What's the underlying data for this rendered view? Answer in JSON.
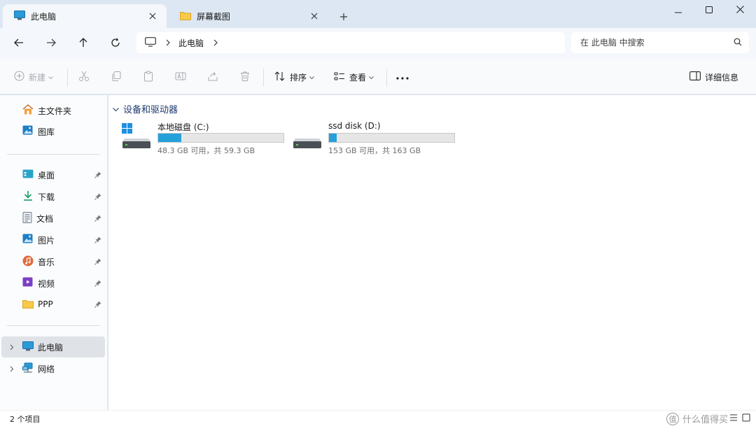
{
  "colors": {
    "accent": "#26a0da",
    "tabbar_bg": "#dde7f3",
    "group_header": "#1e3a6e"
  },
  "tabs": [
    {
      "label": "此电脑",
      "icon": "monitor-icon",
      "active": true
    },
    {
      "label": "屏幕截图",
      "icon": "folder-icon",
      "active": false
    }
  ],
  "window_controls": {
    "minimize": "minimize-icon",
    "maximize": "maximize-icon",
    "close": "close-icon"
  },
  "address": {
    "crumbs": [
      "此电脑"
    ],
    "search_placeholder": "在 此电脑 中搜索"
  },
  "commands": {
    "new": "新建",
    "sort": "排序",
    "view": "查看",
    "details": "详细信息"
  },
  "sidebar": {
    "top": [
      {
        "label": "主文件夹",
        "icon": "home-icon"
      },
      {
        "label": "图库",
        "icon": "gallery-icon"
      }
    ],
    "pinned": [
      {
        "label": "桌面",
        "icon": "desktop-icon"
      },
      {
        "label": "下载",
        "icon": "download-icon"
      },
      {
        "label": "文档",
        "icon": "document-icon"
      },
      {
        "label": "图片",
        "icon": "pictures-icon"
      },
      {
        "label": "音乐",
        "icon": "music-icon"
      },
      {
        "label": "视频",
        "icon": "video-icon"
      },
      {
        "label": "PPP",
        "icon": "folder-icon"
      }
    ],
    "bottom": [
      {
        "label": "此电脑",
        "icon": "monitor-icon",
        "selected": true
      },
      {
        "label": "网络",
        "icon": "network-icon",
        "selected": false
      }
    ]
  },
  "content": {
    "group_label": "设备和驱动器",
    "drives": [
      {
        "name": "本地磁盘 (C:)",
        "free_text": "48.3 GB 可用，共 59.3 GB",
        "used_fraction": 0.186
      },
      {
        "name": "ssd disk (D:)",
        "free_text": "153 GB 可用，共 163 GB",
        "used_fraction": 0.061
      }
    ]
  },
  "status": {
    "item_count": "2 个项目"
  },
  "watermark": {
    "badge": "值",
    "text": "什么值得买"
  }
}
